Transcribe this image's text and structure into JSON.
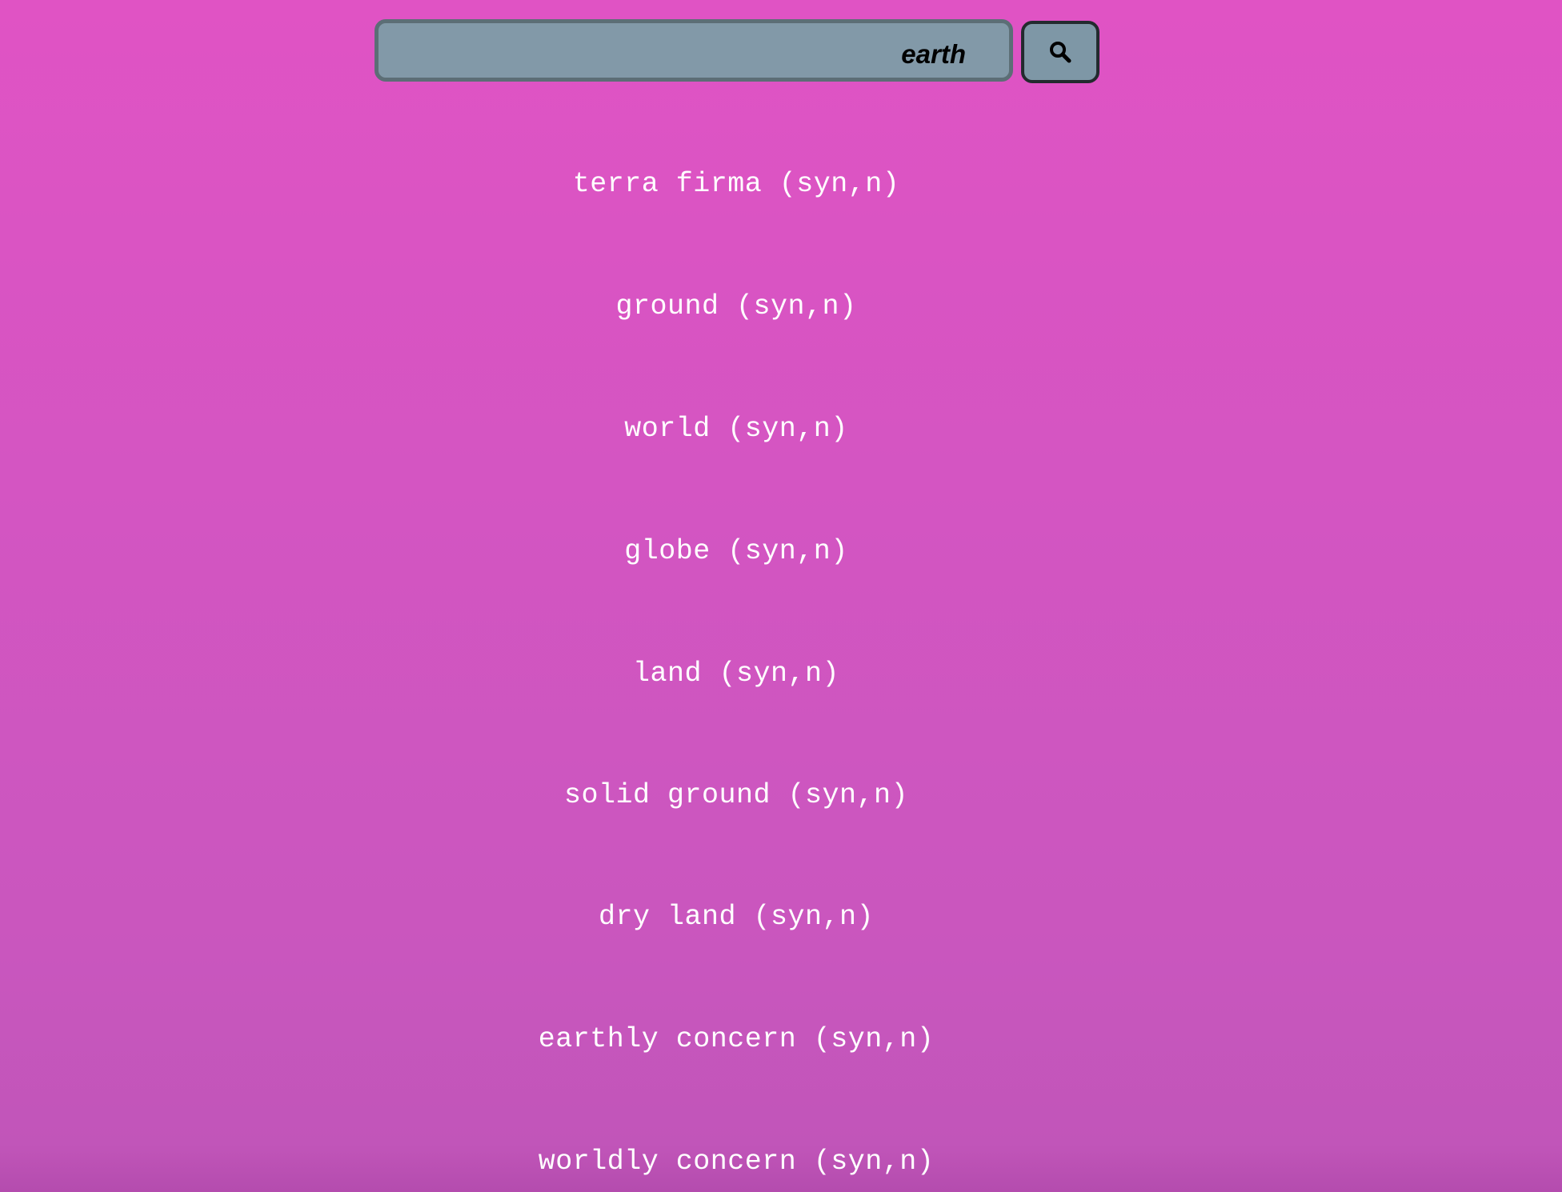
{
  "search": {
    "query": "earth",
    "button_icon": "search-icon"
  },
  "results": [
    "terra firma (syn,n)",
    "ground (syn,n)",
    "world (syn,n)",
    "globe (syn,n)",
    "land (syn,n)",
    "solid ground (syn,n)",
    "dry land (syn,n)",
    "earthly concern (syn,n)",
    "worldly concern (syn,n)"
  ],
  "colors": {
    "background_top": "#e053c4",
    "background_bottom": "#c155b9",
    "input_background": "#8299a8",
    "input_border": "#5c6e76",
    "button_border": "#232a2e",
    "result_text": "#ffffff"
  }
}
